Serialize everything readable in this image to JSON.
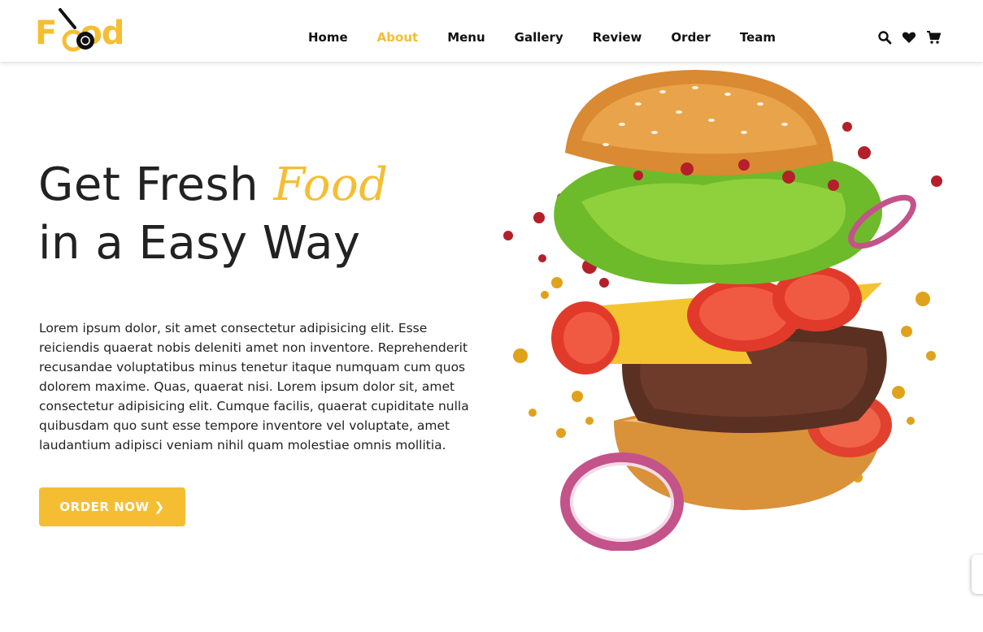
{
  "brand": {
    "logo_text": "Food",
    "accent_color": "#f5be32"
  },
  "nav": {
    "items": [
      {
        "label": "Home",
        "active": false
      },
      {
        "label": "About",
        "active": true
      },
      {
        "label": "Menu",
        "active": false
      },
      {
        "label": "Gallery",
        "active": false
      },
      {
        "label": "Review",
        "active": false
      },
      {
        "label": "Order",
        "active": false
      },
      {
        "label": "Team",
        "active": false
      }
    ]
  },
  "header_icons": [
    "search-icon",
    "heart-icon",
    "cart-icon"
  ],
  "hero": {
    "headline_part1": "Get Fresh ",
    "headline_accent": "Food",
    "headline_line2": "in a Easy Way",
    "description": "Lorem ipsum dolor, sit amet consectetur adipisicing elit. Esse reiciendis quaerat nobis deleniti amet non inventore. Reprehenderit recusandae voluptatibus minus tenetur itaque numquam cum quos dolorem maxime. Quas, quaerat nisi. Lorem ipsum dolor sit, amet consectetur adipisicing elit. Cumque facilis, quaerat cupiditate nulla quibusdam quo sunt esse tempore inventore vel voluptate, amet laudantium adipisci veniam nihil quam molestiae omnis mollitia.",
    "cta_label": "ORDER NOW",
    "cta_icon": "chevron-right-icon"
  }
}
